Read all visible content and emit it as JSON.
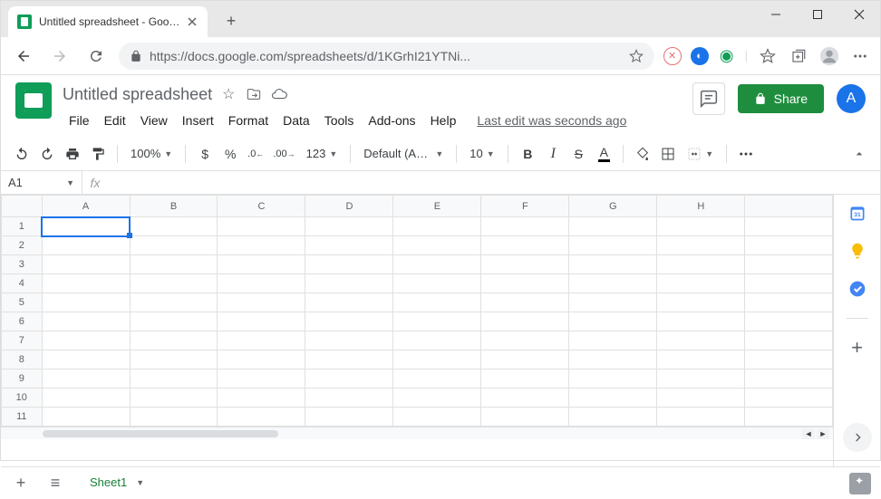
{
  "browser": {
    "tab_title": "Untitled spreadsheet - Google Sh",
    "url": "https://docs.google.com/spreadsheets/d/1KGrhI21YTNi..."
  },
  "doc": {
    "title": "Untitled spreadsheet",
    "last_edit": "Last edit was seconds ago",
    "menus": [
      "File",
      "Edit",
      "View",
      "Insert",
      "Format",
      "Data",
      "Tools",
      "Add-ons",
      "Help"
    ],
    "share_label": "Share",
    "avatar_letter": "A"
  },
  "toolbar": {
    "zoom": "100%",
    "font": "Default (Ari...",
    "font_size": "10",
    "currency": "$",
    "percent": "%",
    "dec_dec": ".0",
    "dec_inc": ".00",
    "numfmt": "123",
    "bold": "B",
    "italic": "I",
    "strike": "S",
    "textcolor": "A"
  },
  "formula": {
    "cell_ref": "A1",
    "fx": "fx"
  },
  "grid": {
    "columns": [
      "A",
      "B",
      "C",
      "D",
      "E",
      "F",
      "G",
      "H",
      ""
    ],
    "rows": [
      1,
      2,
      3,
      4,
      5,
      6,
      7,
      8,
      9,
      10,
      11
    ],
    "selected": "A1"
  },
  "sheets": {
    "active": "Sheet1"
  },
  "sidepanel": {
    "calendar_day": "31"
  }
}
